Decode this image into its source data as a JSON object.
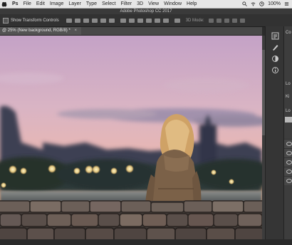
{
  "menubar": {
    "apple_icon": "apple-icon",
    "items": [
      "Ps",
      "File",
      "Edit",
      "Image",
      "Layer",
      "Type",
      "Select",
      "Filter",
      "3D",
      "View",
      "Window",
      "Help"
    ],
    "battery": "100%"
  },
  "window": {
    "title": "Adobe Photoshop CC 2017"
  },
  "options_bar": {
    "show_transform_controls": "Show Transform Controls",
    "mode_label": "3D Mode:"
  },
  "document": {
    "tab_title": "@ 25% (New background, RGB/8) *",
    "close": "×"
  },
  "panel": {
    "label_top": "Co",
    "label_layers": "Lo",
    "label_kind": "Ki",
    "label_lock": "Lo"
  },
  "colors": {
    "menubar": "#e6e6e6",
    "chrome_dark": "#323232",
    "sky_top": "#c9a3c0",
    "sky_mid": "#e0b6bf",
    "horizon_glow": "#f2a878",
    "jacket": "#7c6246",
    "hair": "#d4a86a",
    "stone": "#5e5550"
  },
  "icons": [
    "search-icon",
    "wifi-icon",
    "clock-icon",
    "menu-icon",
    "eye-icon",
    "history-icon",
    "adjustments-icon",
    "info-icon"
  ]
}
